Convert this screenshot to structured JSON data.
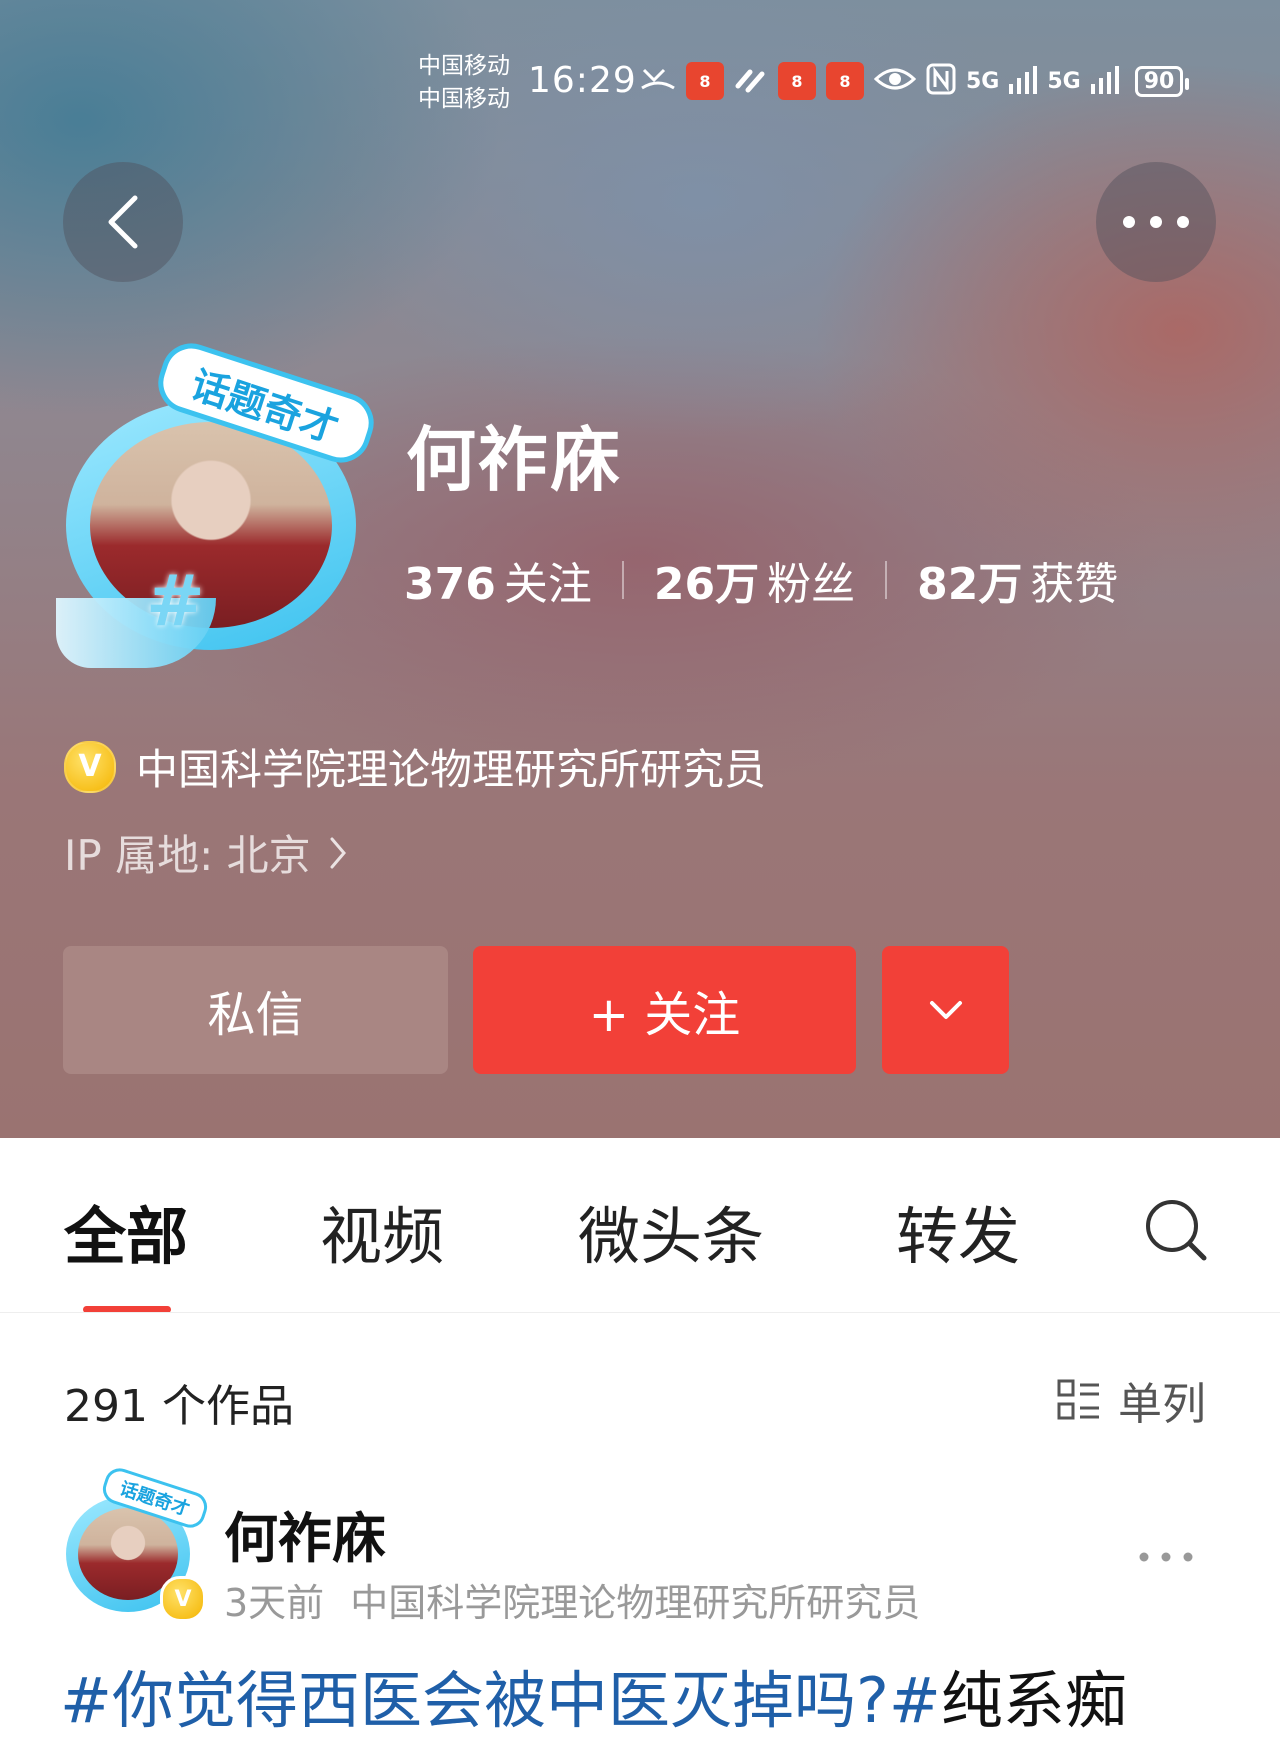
{
  "status_bar": {
    "carrier_1": "中国移动",
    "carrier_2": "中国移动",
    "time": "16:29",
    "app_badge": "8",
    "signal_1": "5G",
    "signal_2": "5G",
    "battery": "90"
  },
  "profile": {
    "name": "何祚庥",
    "topic_badge": "话题奇才",
    "avatar_hashtag": "#",
    "stats": [
      {
        "value": "376",
        "label": "关注"
      },
      {
        "value": "26万",
        "label": "粉丝"
      },
      {
        "value": "82万",
        "label": "获赞"
      }
    ],
    "verify_badge": "V",
    "verification": "中国科学院理论物理研究所研究员",
    "ip_location": "IP 属地: 北京"
  },
  "actions": {
    "message": "私信",
    "follow": "+ 关注"
  },
  "tabs": [
    {
      "label": "全部",
      "active": true
    },
    {
      "label": "视频",
      "active": false
    },
    {
      "label": "微头条",
      "active": false
    },
    {
      "label": "转发",
      "active": false
    }
  ],
  "works": {
    "count": "291 个作品",
    "layout": "单列"
  },
  "post": {
    "author": "何祚庥",
    "badge": "话题奇才",
    "verify_badge": "V",
    "time": "3天前",
    "author_desc": "中国科学院理论物理研究所研究员",
    "topic": "#你觉得西医会被中医灭掉吗?#",
    "text": "纯系痴"
  },
  "colors": {
    "accent": "#f24038",
    "topic_link": "#1f5fa8",
    "message_button": "#a98683"
  }
}
